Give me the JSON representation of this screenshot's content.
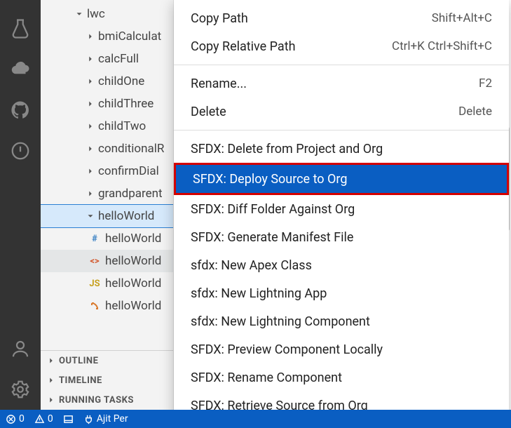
{
  "tree": {
    "root": "lwc",
    "folders": [
      "bmiCalculat",
      "calcFull",
      "childOne",
      "childThree",
      "childTwo",
      "conditionalR",
      "confirmDial",
      "grandparent"
    ],
    "open_folder": "helloWorld",
    "files": [
      "helloWorld",
      "helloWorld",
      "helloWorld",
      "helloWorld"
    ]
  },
  "sections": {
    "outline": "OUTLINE",
    "timeline": "TIMELINE",
    "running": "RUNNING TASKS"
  },
  "menu": {
    "copy_path": "Copy Path",
    "copy_path_key": "Shift+Alt+C",
    "copy_rel": "Copy Relative Path",
    "copy_rel_key": "Ctrl+K Ctrl+Shift+C",
    "rename": "Rename...",
    "rename_key": "F2",
    "delete": "Delete",
    "delete_key": "Delete",
    "sfdx_delete": "SFDX: Delete from Project and Org",
    "sfdx_deploy": "SFDX: Deploy Source to Org",
    "sfdx_diff": "SFDX: Diff Folder Against Org",
    "sfdx_manifest": "SFDX: Generate Manifest File",
    "sfdx_apex": "sfdx: New Apex Class",
    "sfdx_lapp": "sfdx: New Lightning App",
    "sfdx_lcomp": "sfdx: New Lightning Component",
    "sfdx_preview": "SFDX: Preview Component Locally",
    "sfdx_rename": "SFDX: Rename Component",
    "sfdx_retrieve": "SFDX: Retrieve Source from Org"
  },
  "status": {
    "errors": "0",
    "warnings": "0",
    "user": "Ajit Per"
  }
}
